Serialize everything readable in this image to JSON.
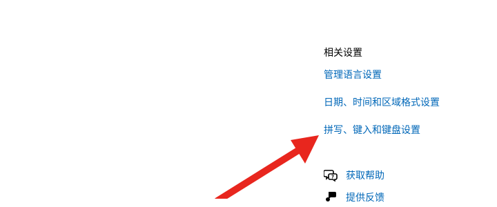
{
  "related_settings": {
    "title": "相关设置",
    "links": [
      "管理语言设置",
      "日期、时间和区域格式设置",
      "拼写、键入和键盘设置"
    ]
  },
  "help": {
    "get_help": {
      "label": "获取帮助",
      "icon": "chat-help-icon"
    },
    "feedback": {
      "label": "提供反馈",
      "icon": "feedback-icon"
    }
  },
  "annotation": {
    "arrow_color": "#e8261e"
  },
  "colors": {
    "link": "#0067b8",
    "text": "#000000",
    "background": "#ffffff"
  }
}
